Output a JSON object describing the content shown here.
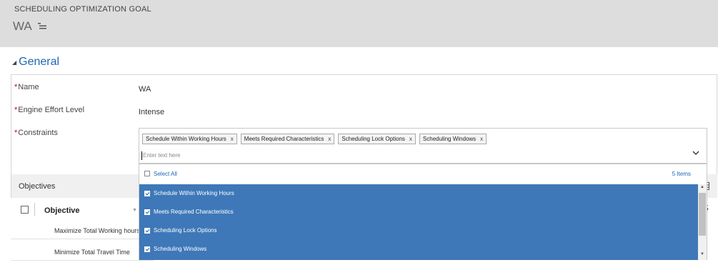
{
  "header": {
    "entity_type": "SCHEDULING OPTIMIZATION GOAL",
    "record_title": "WA"
  },
  "section": {
    "title": "General"
  },
  "fields": {
    "name": {
      "label": "Name",
      "value": "WA"
    },
    "effort": {
      "label": "Engine Effort Level",
      "value": "Intense"
    },
    "constraints": {
      "label": "Constraints",
      "tags": [
        "Schedule Within Working Hours",
        "Meets Required Characteristics",
        "Scheduling Lock Options",
        "Scheduling Windows"
      ],
      "remove_glyph": "x",
      "placeholder": "Enter text here"
    }
  },
  "required_marker": "*",
  "dropdown": {
    "select_all": "Select All",
    "count": "5 Items",
    "items": [
      "Schedule Within Working Hours",
      "Meets Required Characteristics",
      "Scheduling Lock Options",
      "Scheduling Windows"
    ]
  },
  "objectives": {
    "title": "Objectives",
    "column": "Objective",
    "rows": [
      "Maximize Total Working hours",
      "Minimize Total Travel Time"
    ]
  },
  "icons": {
    "menu": "menu-icon",
    "chevron": "chevron-down-icon",
    "grid": "grid-icon",
    "refresh": "refresh-icon"
  },
  "colors": {
    "accent": "#1f66b3",
    "selection": "#3e78b8",
    "required": "#cc0000",
    "header_bg": "#dddddd"
  }
}
